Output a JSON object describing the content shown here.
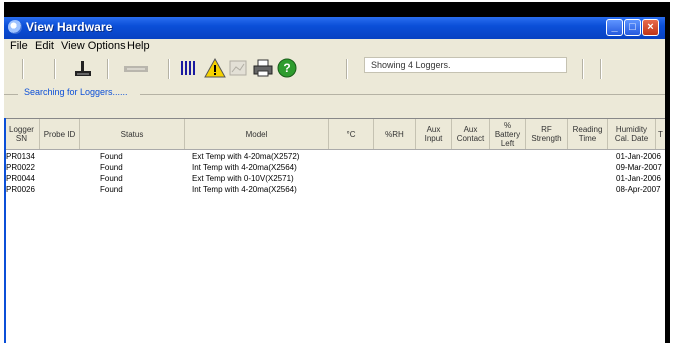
{
  "window": {
    "title": "View Hardware"
  },
  "menu": [
    "File",
    "Edit",
    "View Options",
    "Help"
  ],
  "toolbar": {
    "status_text": "Showing 4 Loggers."
  },
  "search": {
    "text": "Searching for Loggers......"
  },
  "table": {
    "columns": [
      "Logger\nSN",
      "Probe ID",
      "Status",
      "Model",
      "°C",
      "%RH",
      "Aux\nInput",
      "Aux\nContact",
      "%\nBattery\nLeft",
      "RF\nStrength",
      "Reading\nTime",
      "Humidity\nCal. Date",
      "T"
    ],
    "rows": [
      {
        "sn": "PR0134",
        "probe": "",
        "status": "Found",
        "model": "Ext Temp with 4-20ma(X2572)",
        "cal": "01-Jan-2006"
      },
      {
        "sn": "PR0022",
        "probe": "",
        "status": "Found",
        "model": "Int Temp with 4-20ma(X2564)",
        "cal": "09-Mar-2007"
      },
      {
        "sn": "PR0044",
        "probe": "",
        "status": "Found",
        "model": "Ext Temp with 0-10V(X2571)",
        "cal": "01-Jan-2006"
      },
      {
        "sn": "PR0026",
        "probe": "",
        "status": "Found",
        "model": "Int Temp with 4-20ma(X2564)",
        "cal": "08-Apr-2007"
      }
    ]
  },
  "colors": {
    "titlebar": "#0b4fd8",
    "chrome": "#ece9d8"
  }
}
